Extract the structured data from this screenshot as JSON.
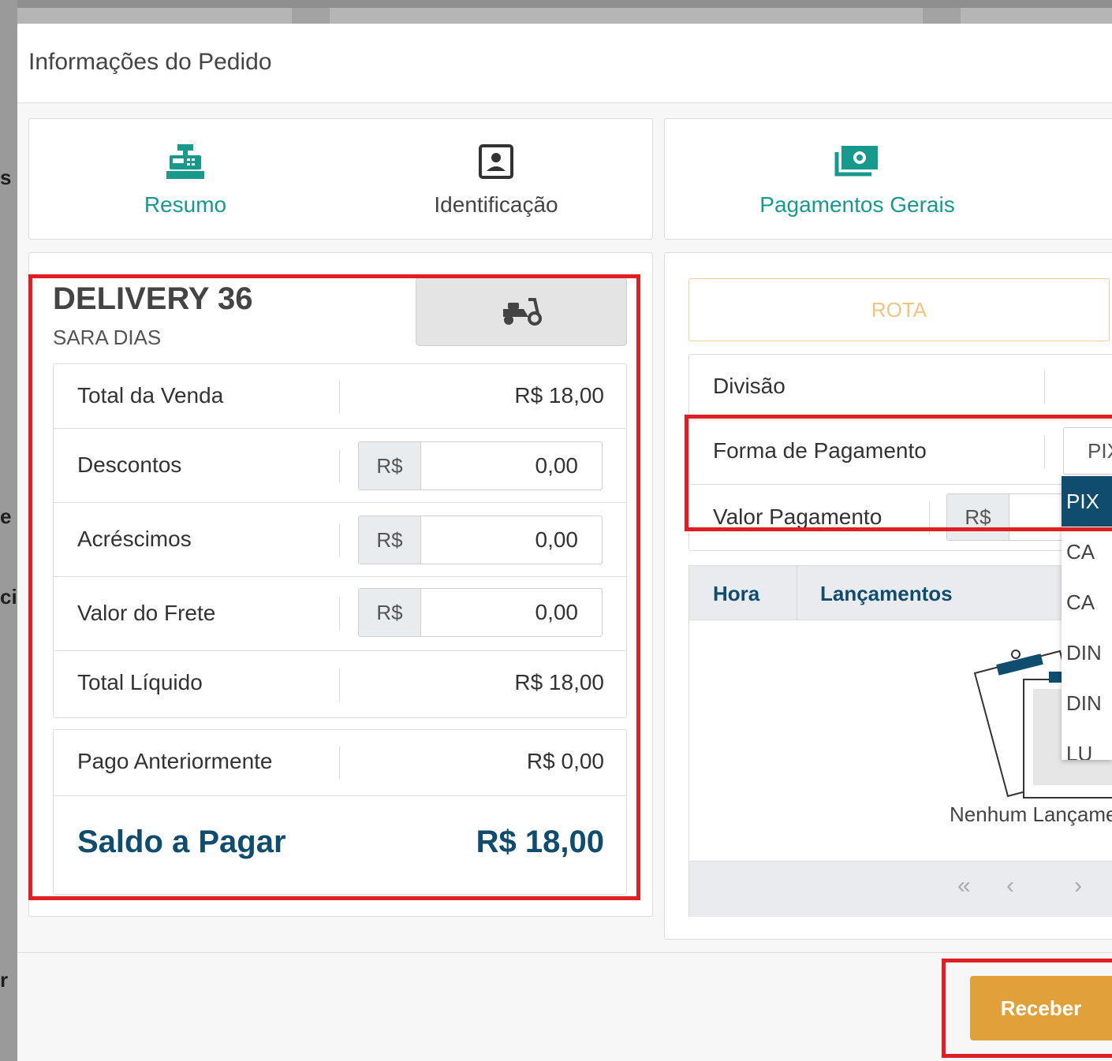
{
  "background": {
    "fragments": [
      "s",
      "e",
      "ci",
      "r"
    ]
  },
  "modal": {
    "title": "Informações do Pedido"
  },
  "tabs": [
    {
      "label": "Resumo",
      "icon": "cash-register-icon",
      "active": true
    },
    {
      "label": "Identificação",
      "icon": "id-card-icon",
      "active": false
    },
    {
      "label": "Pagamentos Gerais",
      "icon": "money-bill-icon",
      "active": true
    }
  ],
  "summary": {
    "order_title": "DELIVERY 36",
    "customer_name": "SARA DIAS",
    "delivery_icon": "motorcycle-icon",
    "rows": {
      "total_venda": {
        "label": "Total da Venda",
        "value": "R$ 18,00"
      },
      "descontos": {
        "label": "Descontos",
        "prefix": "R$",
        "value": "0,00"
      },
      "acrescimos": {
        "label": "Acréscimos",
        "prefix": "R$",
        "value": "0,00"
      },
      "frete": {
        "label": "Valor do Frete",
        "prefix": "R$",
        "value": "0,00"
      },
      "total_liquido": {
        "label": "Total Líquido",
        "value": "R$ 18,00"
      },
      "pago_anteriormente": {
        "label": "Pago Anteriormente",
        "value": "R$ 0,00"
      },
      "saldo": {
        "label": "Saldo a Pagar",
        "value": "R$ 18,00"
      }
    }
  },
  "payment": {
    "rota_label": "ROTA",
    "divisao_label": "Divisão",
    "forma_label": "Forma de Pagamento",
    "forma_selected": "PIX",
    "valor_label": "Valor Pagamento",
    "valor_prefix": "R$",
    "dropdown_options": [
      "PIX",
      "CA",
      "CA",
      "DIN",
      "DIN",
      "LU"
    ],
    "table_headers": {
      "hora": "Hora",
      "lancamentos": "Lançamentos"
    },
    "empty_text": "Nenhum Lançame",
    "pager": {
      "first": "«",
      "prev": "‹",
      "next": "›"
    }
  },
  "footer": {
    "receber_label": "Receber"
  },
  "colors": {
    "teal": "#17998e",
    "navy": "#0f4c6e",
    "orange": "#e0a03a",
    "red_highlight": "#e01e25"
  }
}
